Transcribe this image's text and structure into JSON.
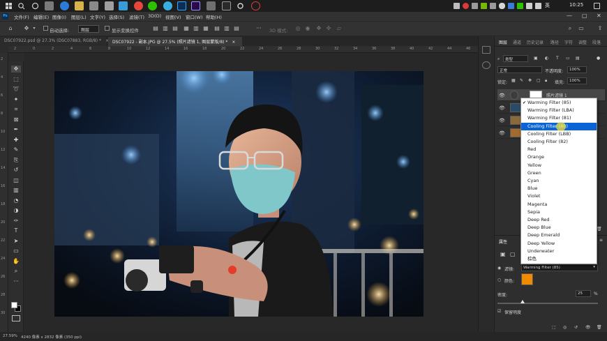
{
  "taskbar": {
    "clock": "10:25",
    "ime_label": "英",
    "colors": {
      "chrome_red": "#e8463b",
      "wechat_green": "#2dc100",
      "ps_blue": "#31a8ff",
      "record_red": "#e23d3d"
    }
  },
  "app": {
    "logo_label": "Ps",
    "menu": [
      "文件(F)",
      "编辑(E)",
      "图像(I)",
      "图层(L)",
      "文字(Y)",
      "选择(S)",
      "滤镜(T)",
      "3D(D)",
      "视图(V)",
      "窗口(W)",
      "帮助(H)"
    ],
    "window_controls": {
      "minimize": "—",
      "restore": "▢",
      "close": "✕"
    }
  },
  "options": {
    "auto_select_label": "自动选择:",
    "auto_select_value": "图层",
    "show_transform_label": "显示变换控件",
    "mode_3d_label": "3D 模式:"
  },
  "tabs": [
    {
      "label": "DSC07922.psd @ 27.3% (DSC07883, RGB/8) *",
      "close": "×",
      "active": false
    },
    {
      "label": "DSC07922 - 副本.JPG @ 27.5% (照片滤镜 1, 图层蒙版/8) *",
      "close": "×",
      "active": true
    }
  ],
  "rulers": {
    "top": [
      "2",
      "0",
      "2",
      "4",
      "6",
      "8",
      "10",
      "12",
      "14",
      "16",
      "18",
      "20",
      "22",
      "24",
      "26",
      "28",
      "30",
      "32",
      "34",
      "36",
      "38",
      "40",
      "42",
      "44",
      "46"
    ],
    "left": [
      "2",
      "4",
      "6",
      "8",
      "10",
      "12",
      "14",
      "16",
      "18",
      "20",
      "22",
      "24",
      "26",
      "28",
      "30"
    ]
  },
  "toolbar": {
    "tools": [
      "move",
      "marquee",
      "lasso",
      "quick-select",
      "crop",
      "frame",
      "eyedropper",
      "healing",
      "brush",
      "stamp",
      "history-brush",
      "eraser",
      "gradient",
      "blur",
      "dodge",
      "pen",
      "type",
      "path-select",
      "rectangle",
      "hand",
      "zoom"
    ],
    "more_label": "···"
  },
  "status": {
    "zoom": "27.59%",
    "doc_info": "4240 像素 x 2832 像素 (350 ppi)"
  },
  "layers_panel": {
    "tabs": [
      "图层",
      "通道",
      "历史记录",
      "路径",
      "字符",
      "调整",
      "段落"
    ],
    "filter_kind": "类型",
    "blend_mode": "正常",
    "opacity_label": "不透明度:",
    "opacity_value": "100%",
    "lock_label": "锁定:",
    "fill_label": "填充:",
    "fill_value": "100%",
    "top_layer_name": "照片滤镜 1"
  },
  "properties_panel": {
    "title": "属性",
    "filter_label": "滤镜:",
    "filter_value": "Warming Filter (85)",
    "color_label": "颜色:",
    "color_swatch": "#f08a00",
    "density_label": "密度:",
    "density_value": "25",
    "density_unit": "%",
    "density_fraction": 0.25,
    "preserve_label": "保留明度",
    "preserve_checked": true
  },
  "filter_dropdown": {
    "checked_index": 0,
    "highlighted_index": 3,
    "options": [
      "Warming Filter (85)",
      "Warming Filter (LBA)",
      "Warming Filter (81)",
      "Cooling Filter (80)",
      "Cooling Filter (LBB)",
      "Cooling Filter (82)",
      "Red",
      "Orange",
      "Yellow",
      "Green",
      "Cyan",
      "Blue",
      "Violet",
      "Magenta",
      "Sepia",
      "Deep Red",
      "Deep Blue",
      "Deep Emerald",
      "Deep Yellow",
      "Underwater",
      "棕色"
    ]
  }
}
